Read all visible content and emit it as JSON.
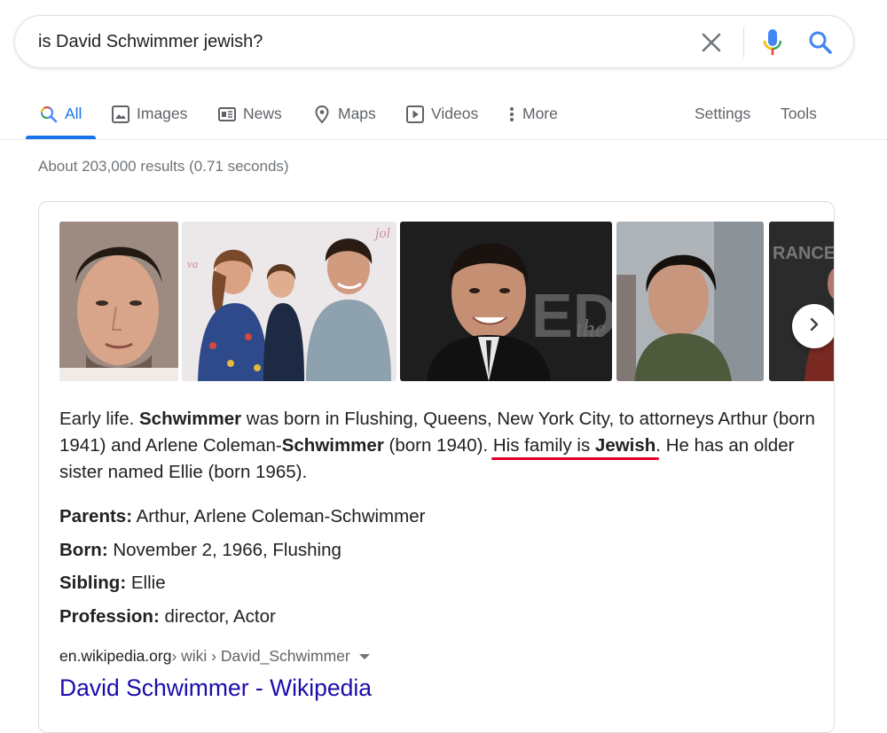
{
  "search": {
    "query": "is David Schwimmer jewish?"
  },
  "tabs": [
    {
      "label": "All",
      "icon": "search-icon"
    },
    {
      "label": "Images",
      "icon": "image-icon"
    },
    {
      "label": "News",
      "icon": "news-icon"
    },
    {
      "label": "Maps",
      "icon": "map-pin-icon"
    },
    {
      "label": "Videos",
      "icon": "play-icon"
    },
    {
      "label": "More",
      "icon": "more-vert-icon"
    },
    {
      "label": "Settings"
    },
    {
      "label": "Tools"
    }
  ],
  "result_stats": "About 203,000 results (0.71 seconds)",
  "snippet": {
    "p1": "Early life. ",
    "b1": "Schwimmer",
    "p2": " was born in Flushing, Queens, New York City, to attorneys Arthur (born 1941) and Arlene Coleman-",
    "b2": "Schwimmer",
    "p3": " (born 1940). ",
    "hl_text": "His family is ",
    "hl_bold": "Jewish",
    "p4": ". He has an older sister named Ellie (born 1965)."
  },
  "facts": [
    {
      "key": "Parents:",
      "value": " Arthur, Arlene Coleman-Schwimmer"
    },
    {
      "key": "Born:",
      "value": " November 2, 1966, Flushing"
    },
    {
      "key": "Sibling:",
      "value": " Ellie"
    },
    {
      "key": "Profession:",
      "value": " director, Actor"
    }
  ],
  "source": {
    "domain": "en.wikipedia.org",
    "path": " › wiki › David_Schwimmer",
    "title": "David Schwimmer - Wikipedia"
  },
  "colors": {
    "link": "#1a0dab",
    "accent": "#1a73e8",
    "highlight_underline": "#e0002b"
  }
}
